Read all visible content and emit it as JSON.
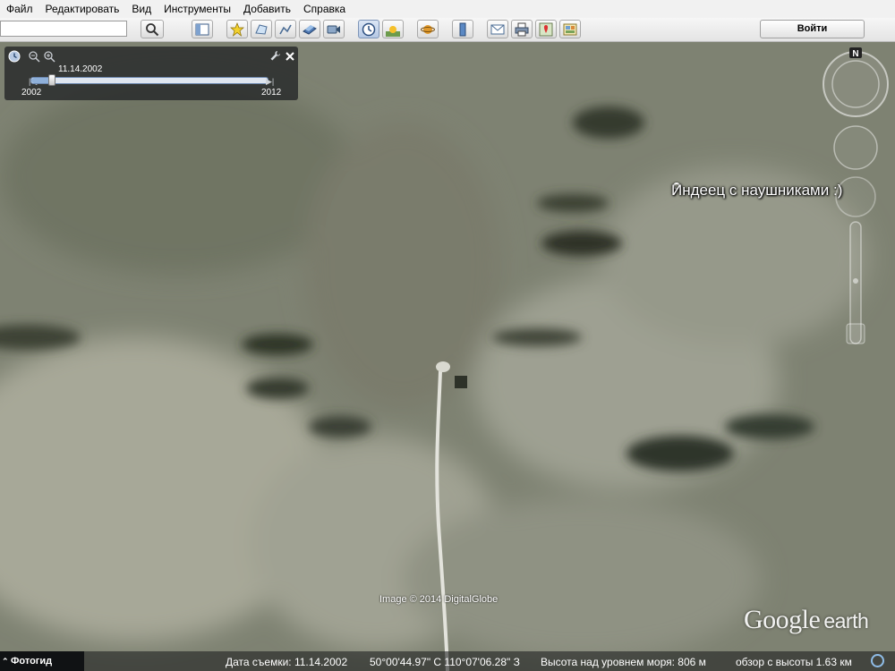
{
  "menu": [
    "Файл",
    "Редактировать",
    "Вид",
    "Инструменты",
    "Добавить",
    "Справка"
  ],
  "search": {
    "value": "",
    "placeholder": ""
  },
  "toolbar_buttons": [
    "search-icon",
    "sidebar-icon",
    "placemark-icon",
    "polygon-icon",
    "path-icon",
    "image-overlay-icon",
    "record-tour-icon",
    "historical-imagery-icon",
    "sunlight-icon",
    "planets-icon",
    "ruler-icon",
    "email-icon",
    "print-icon",
    "google-maps-icon",
    "gallery-icon"
  ],
  "signin_label": "Войти",
  "timeslider": {
    "current_date": "11.14.2002",
    "start_year": "2002",
    "end_year": "2012",
    "position": 0.09
  },
  "placemark": {
    "label": "Индеец с наушниками :)"
  },
  "navigation": {
    "north_label": "N"
  },
  "image_credit": "Image © 2014 DigitalGlobe",
  "logo": {
    "google": "Google",
    "earth": "earth"
  },
  "status": {
    "tour_guide": "Фотогид",
    "capture_date": "Дата съемки: 11.14.2002",
    "coordinates": "50°00'44.97\" С  110°07'06.28\" З",
    "elevation": "Высота над уровнем моря:   806 м",
    "eye_altitude": "обзор с высоты   1.63 км"
  },
  "colors": {
    "terrain": "#7d8070",
    "accent": "#8fb0d9"
  }
}
